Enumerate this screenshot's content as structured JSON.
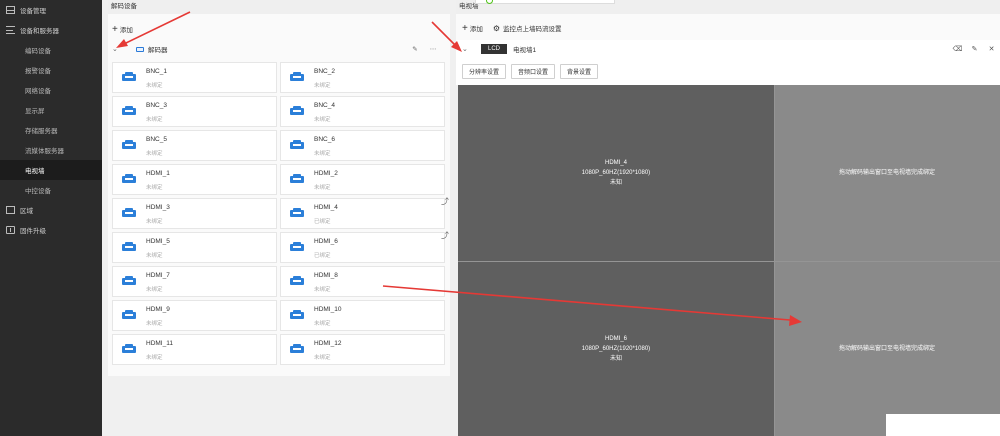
{
  "sidebar": {
    "items": [
      {
        "label": "设备管理",
        "level": "top",
        "icon": "grid-icon",
        "active": false
      },
      {
        "label": "设备和服务器",
        "level": "top",
        "icon": "list-icon",
        "active": false
      },
      {
        "label": "编码设备",
        "level": "sub",
        "active": false
      },
      {
        "label": "报警设备",
        "level": "sub",
        "active": false
      },
      {
        "label": "网络设备",
        "level": "sub",
        "active": false
      },
      {
        "label": "显示屏",
        "level": "sub",
        "active": false
      },
      {
        "label": "存储服务器",
        "level": "sub",
        "active": false
      },
      {
        "label": "流媒体服务器",
        "level": "sub",
        "active": false
      },
      {
        "label": "电视墙",
        "level": "sub",
        "active": true
      },
      {
        "label": "中控设备",
        "level": "sub",
        "active": false
      },
      {
        "label": "区域",
        "level": "top",
        "icon": "square-icon",
        "active": false
      },
      {
        "label": "固件升级",
        "level": "top",
        "icon": "upgrade-icon",
        "active": false
      }
    ]
  },
  "left_panel": {
    "title": "解码设备",
    "add_label": "添加",
    "group_label": "解码器",
    "cards": [
      {
        "name": "BNC_1",
        "status": "未绑定",
        "linked": false
      },
      {
        "name": "BNC_2",
        "status": "未绑定",
        "linked": false
      },
      {
        "name": "BNC_3",
        "status": "未绑定",
        "linked": false
      },
      {
        "name": "BNC_4",
        "status": "未绑定",
        "linked": false
      },
      {
        "name": "BNC_5",
        "status": "未绑定",
        "linked": false
      },
      {
        "name": "BNC_6",
        "status": "未绑定",
        "linked": false
      },
      {
        "name": "HDMI_1",
        "status": "未绑定",
        "linked": false
      },
      {
        "name": "HDMI_2",
        "status": "未绑定",
        "linked": false
      },
      {
        "name": "HDMI_3",
        "status": "未绑定",
        "linked": false
      },
      {
        "name": "HDMI_4",
        "status": "已绑定",
        "linked": true
      },
      {
        "name": "HDMI_5",
        "status": "未绑定",
        "linked": false
      },
      {
        "name": "HDMI_6",
        "status": "已绑定",
        "linked": true
      },
      {
        "name": "HDMI_7",
        "status": "未绑定",
        "linked": false
      },
      {
        "name": "HDMI_8",
        "status": "未绑定",
        "linked": false
      },
      {
        "name": "HDMI_9",
        "status": "未绑定",
        "linked": false
      },
      {
        "name": "HDMI_10",
        "status": "未绑定",
        "linked": false
      },
      {
        "name": "HDMI_11",
        "status": "未绑定",
        "linked": false
      },
      {
        "name": "HDMI_12",
        "status": "未绑定",
        "linked": false
      }
    ]
  },
  "right_panel": {
    "title": "电视墙",
    "add_label": "添加",
    "settings_label": "监控点上墙码流设置",
    "wall_tag": "LCD",
    "wall_name": "电视墙1",
    "buttons": [
      "分辨率设置",
      "音频口设置",
      "背景设置"
    ],
    "screens": [
      {
        "name": "HDMI_4",
        "resolution": "1080P_60HZ(1920*1080)",
        "status": "未知"
      },
      {
        "hint": "拖动解码输出窗口至电视墙完成绑定"
      },
      {
        "name": "HDMI_6",
        "resolution": "1080P_60HZ(1920*1080)",
        "status": "未知"
      },
      {
        "hint": "拖动解码输出窗口至电视墙完成绑定"
      }
    ]
  },
  "colors": {
    "sidebar_bg": "#2b2b2b",
    "accent": "#2b7fd9",
    "annotation_arrow": "#e53935"
  }
}
